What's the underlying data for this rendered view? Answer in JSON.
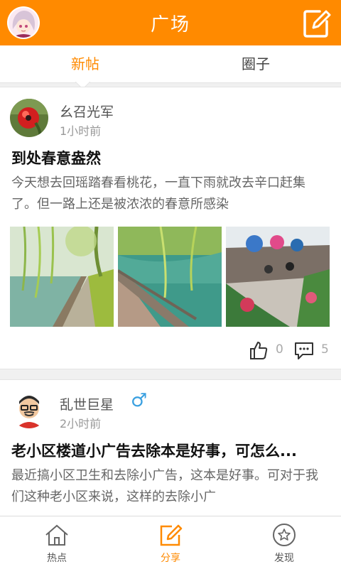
{
  "header": {
    "title": "广场"
  },
  "tabs": [
    {
      "label": "新帖",
      "active": true
    },
    {
      "label": "圈子",
      "active": false
    }
  ],
  "posts": [
    {
      "author": "幺召光军",
      "time": "1小时前",
      "title": "到处春意盎然",
      "body": "今天想去回瑶踏春看桃花，一直下雨就改去辛口赶集了。但一路上还是被浓浓的春意所感染",
      "likes": "0",
      "comments": "5"
    },
    {
      "author": "乱世巨星",
      "gender_symbol": "♂",
      "time": "2小时前",
      "title": "老小区楼道小广告去除本是好事，可怎么...",
      "body": "最近搞小区卫生和去除小广告，这本是好事。可对于我们这种老小区来说，这样的去除小广"
    }
  ],
  "bottom_nav": [
    {
      "label": "热点",
      "icon": "house-icon"
    },
    {
      "label": "分享",
      "icon": "share-edit-icon",
      "active": true
    },
    {
      "label": "发现",
      "icon": "star-circle-icon"
    }
  ],
  "colors": {
    "accent": "#ff8a00",
    "gender": "#3aa0e0"
  }
}
